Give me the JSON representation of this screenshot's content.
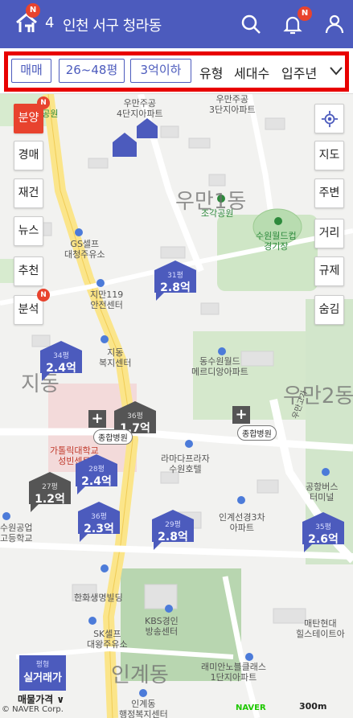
{
  "header": {
    "logo_badge": "N",
    "location_count": "4",
    "location_name": "인천 서구 청라동",
    "bell_badge": "N"
  },
  "filters": {
    "chips": [
      "매매",
      "26~48평",
      "3억이하"
    ],
    "texts": [
      "유형",
      "세대수",
      "입주년"
    ]
  },
  "left_buttons": {
    "items": [
      "분양",
      "경매",
      "재건",
      "뉴스",
      "추천",
      "분석"
    ],
    "badge": "N"
  },
  "right_buttons": {
    "items": [
      "지도",
      "주변",
      "거리",
      "규제",
      "숨김"
    ]
  },
  "map_labels": {
    "park1": "바위공원",
    "apt1": "우만주공\n4단지아파트",
    "apt2": "우만주공\n3단지아파트",
    "park2": "조각공원",
    "gs": "GS셀프\n대청주유소",
    "stadium": "수원월드컵\n경기장",
    "fire": "지만119\n안전센터",
    "welfare": "지동\n복지센터",
    "mall": "동수원월드\n메르디앙아파트",
    "hotel": "라마다프라자\n수원호텔",
    "hospital_label": "가톨릭대학교\n성빈센트",
    "apt3": "인계선경3차\n아파트",
    "busterm": "공항버스\n터미널",
    "school": "수원공업\n고등학교",
    "bldg": "한화생명빌딩",
    "sk": "SK셀프\n대왕주유소",
    "kbs": "KBS경인\n방송센터",
    "raemian": "래미안노블클래스\n1단지아파트",
    "hilstate": "매탄현대\n힐스테이트아",
    "ingye_welfare": "인계동\n행정복지센터",
    "road": "우만고가"
  },
  "big_labels": {
    "uman1": "우만1동",
    "uman2": "우만2동",
    "jidong": "지동",
    "ingye": "인계동"
  },
  "markers": [
    {
      "size": "31평",
      "price": "2.8억",
      "color": "blue"
    },
    {
      "size": "34평",
      "price": "2.4억",
      "color": "blue"
    },
    {
      "size": "36평",
      "price": "1.7억",
      "color": "gray"
    },
    {
      "size": "28평",
      "price": "2.4억",
      "color": "blue"
    },
    {
      "size": "27평",
      "price": "1.2억",
      "color": "gray"
    },
    {
      "size": "36평",
      "price": "2.3억",
      "color": "blue"
    },
    {
      "size": "29평",
      "price": "2.8억",
      "color": "blue"
    },
    {
      "size": "35평",
      "price": "2.6억",
      "color": "blue"
    }
  ],
  "hospitals": [
    "종합병원",
    "종합병원"
  ],
  "bottom": {
    "real_price_small": "평형",
    "real_price": "실거래가",
    "maemul": "매물가격 ∨",
    "copyright": "© NAVER Corp.",
    "naver": "NAVER",
    "scale": "300m"
  },
  "colors": {
    "brand": "#4c5bbd",
    "badge": "#e8432e",
    "highlight": "#e80000",
    "gray_marker": "#555555"
  }
}
